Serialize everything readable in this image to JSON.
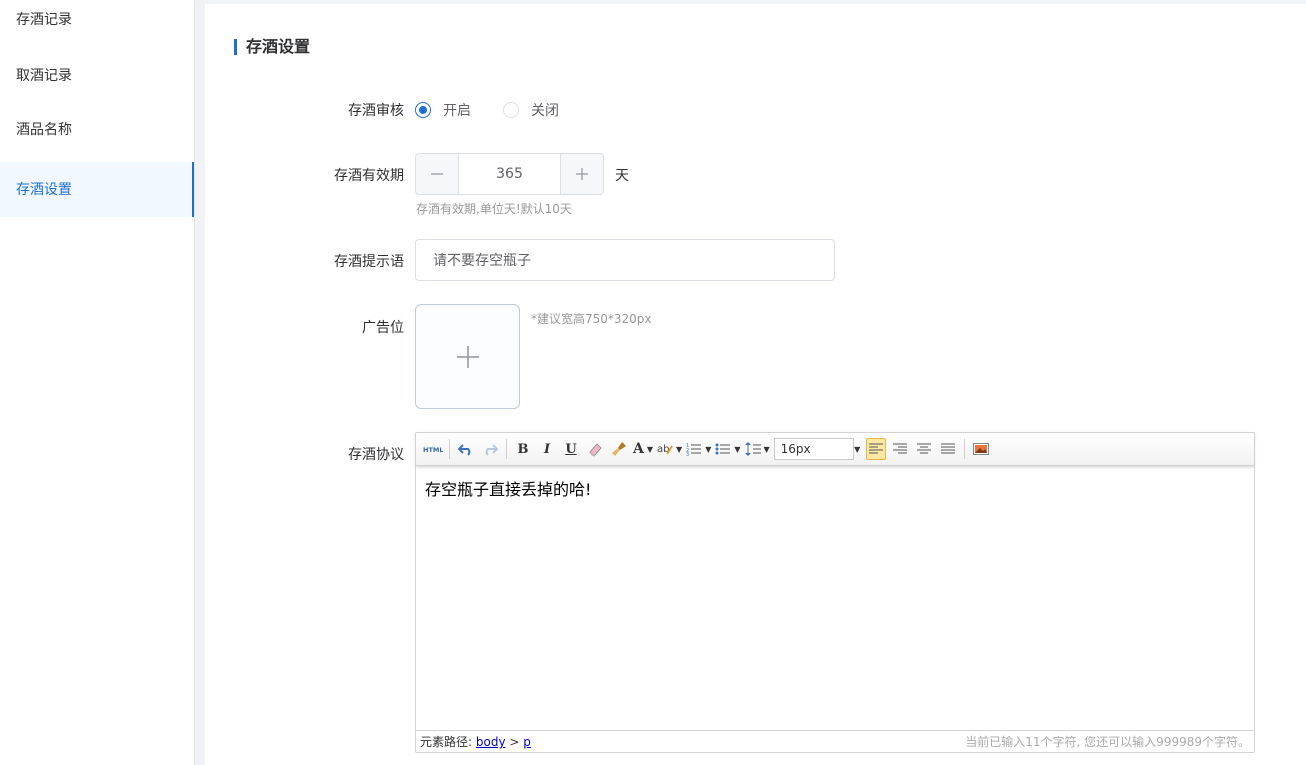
{
  "sidebar": {
    "items": [
      {
        "label": "存酒记录"
      },
      {
        "label": "取酒记录"
      },
      {
        "label": "酒品名称"
      },
      {
        "label": "存酒设置"
      }
    ]
  },
  "page": {
    "title": "存酒设置"
  },
  "form": {
    "review": {
      "label": "存酒审核",
      "options": [
        {
          "label": "开启"
        },
        {
          "label": "关闭"
        }
      ],
      "selected": "开启"
    },
    "validity": {
      "label": "存酒有效期",
      "value": "365",
      "unit": "天",
      "hint": "存酒有效期,单位天!默认10天"
    },
    "prompt": {
      "label": "存酒提示语",
      "value": "请不要存空瓶子"
    },
    "ad": {
      "label": "广告位",
      "hint": "*建议宽高750*320px"
    },
    "agreement": {
      "label": "存酒协议",
      "font_size": "16px",
      "content": "存空瓶子直接丢掉的哈!",
      "path_label": "元素路径:",
      "path": [
        "body",
        "p"
      ],
      "path_separator": ">",
      "counter": "当前已输入11个字符, 您还可以输入999989个字符。"
    }
  },
  "colors": {
    "accent": "#1f6fd1",
    "active_bg": "#f1f8ff"
  }
}
